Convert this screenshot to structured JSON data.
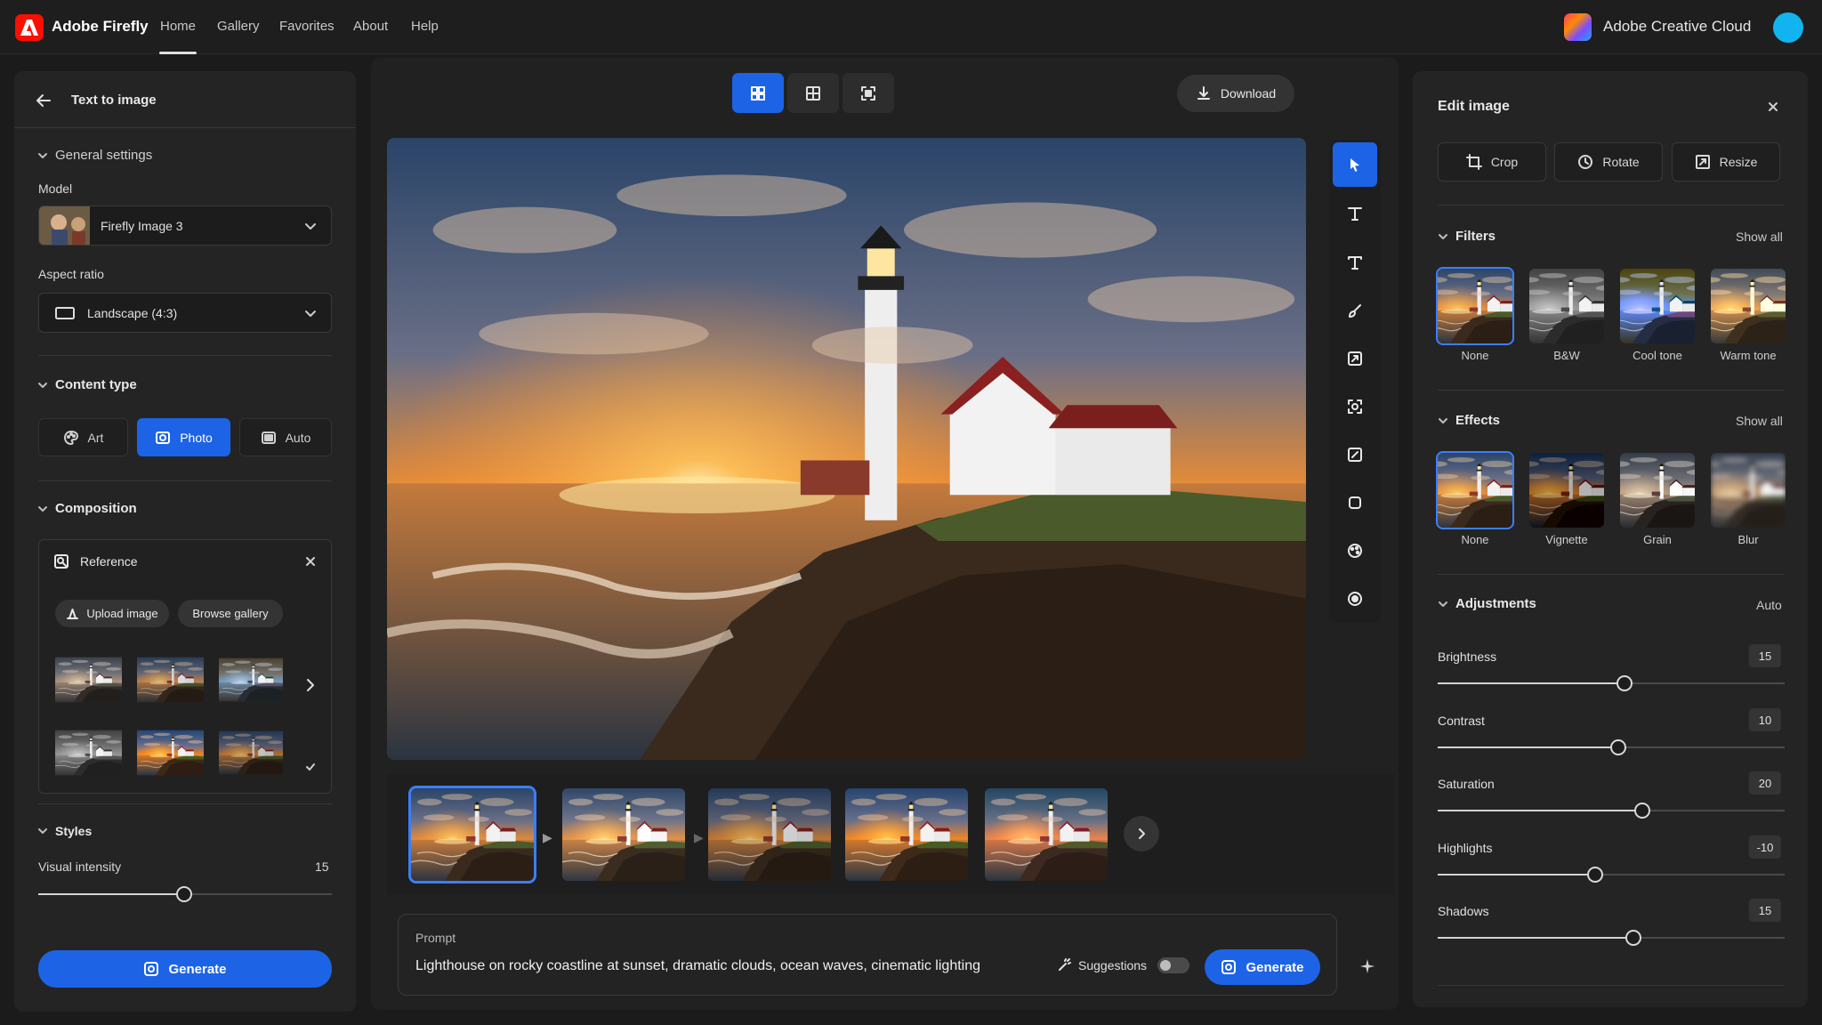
{
  "topbar": {
    "app_name": "Adobe Firefly",
    "nav": [
      "Home",
      "Gallery",
      "Favorites",
      "About",
      "Help"
    ],
    "active_nav": "Home",
    "cloud_label": "Adobe Creative Cloud"
  },
  "left": {
    "title": "Text to image",
    "general_settings": "General settings",
    "model_label": "Model",
    "model_value": "Firefly Image 3",
    "aspect_label": "Aspect ratio",
    "aspect_value": "Landscape (4:3)",
    "content_type": "Content type",
    "content_types": [
      "Art",
      "Photo",
      "Auto"
    ],
    "content_type_selected": "Photo",
    "composition": "Composition",
    "reference": "Reference",
    "upload_image": "Upload image",
    "browse_gallery": "Browse gallery",
    "styles": "Styles",
    "visual_intensity_label": "Visual intensity",
    "visual_intensity_value": "15",
    "visual_intensity_fraction": 0.5,
    "generate": "Generate"
  },
  "center": {
    "download": "Download",
    "prompt_label": "Prompt",
    "prompt_text": "Lighthouse on rocky coastline at sunset, dramatic clouds, ocean waves, cinematic lighting",
    "suggestions": "Suggestions",
    "generate": "Generate",
    "tools": [
      "pointer-icon",
      "text-icon",
      "text-style-icon",
      "brush-icon",
      "expand-icon",
      "scan-icon",
      "resize-icon",
      "crop-icon",
      "palette-icon",
      "sphere-icon"
    ],
    "accent": "#1d63e5"
  },
  "right": {
    "title": "Edit image",
    "crop": "Crop",
    "rotate": "Rotate",
    "resize": "Resize",
    "filters": "Filters",
    "filters_show_all": "Show all",
    "filter_items": [
      "None",
      "B&W",
      "Cool tone",
      "Warm tone"
    ],
    "effects": "Effects",
    "effects_show_all": "Show all",
    "effect_items": [
      "None",
      "Vignette",
      "Grain",
      "Blur"
    ],
    "adjustments": "Adjustments",
    "adjustments_mode": "Auto",
    "adjust": [
      {
        "label": "Brightness",
        "value": "15"
      },
      {
        "label": "Contrast",
        "value": "10"
      },
      {
        "label": "Saturation",
        "value": "20"
      },
      {
        "label": "Highlights",
        "value": "-10"
      },
      {
        "label": "Shadows",
        "value": "15"
      }
    ]
  }
}
